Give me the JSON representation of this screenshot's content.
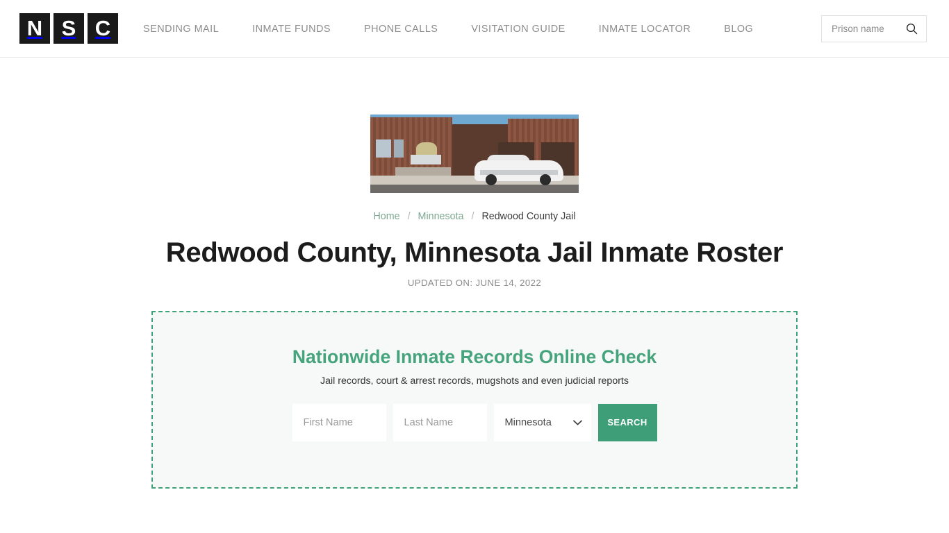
{
  "header": {
    "logo": {
      "tiles": [
        "N",
        "S",
        "C"
      ],
      "alt": "NSC"
    },
    "nav": [
      {
        "label": "SENDING MAIL"
      },
      {
        "label": "INMATE FUNDS"
      },
      {
        "label": "PHONE CALLS"
      },
      {
        "label": "VISITATION GUIDE"
      },
      {
        "label": "INMATE LOCATOR"
      },
      {
        "label": "BLOG"
      }
    ],
    "search": {
      "placeholder": "Prison name",
      "value": "",
      "icon": "search-icon"
    }
  },
  "hero": {
    "image_alt": "Redwood County Jail building exterior with corrections patrol car"
  },
  "breadcrumb": {
    "items": [
      {
        "label": "Home",
        "link": true
      },
      {
        "label": "Minnesota",
        "link": true
      },
      {
        "label": "Redwood County Jail",
        "link": false
      }
    ],
    "separator": "/"
  },
  "page": {
    "title": "Redwood County, Minnesota Jail Inmate Roster",
    "updated_on": "UPDATED ON: JUNE 14, 2022"
  },
  "promo": {
    "title": "Nationwide Inmate Records Online Check",
    "subtitle": "Jail records, court & arrest records, mugshots and even judicial reports",
    "first_name": {
      "placeholder": "First Name",
      "value": ""
    },
    "last_name": {
      "placeholder": "Last Name",
      "value": ""
    },
    "state": {
      "selected": "Minnesota",
      "options": [
        "Minnesota"
      ]
    },
    "submit_label": "SEARCH"
  },
  "colors": {
    "brand_green": "#3d9e78",
    "heading_green": "#46a47c",
    "dashed_border": "#3fa27a",
    "panel_bg": "#f7f9f9",
    "nav_text": "#8c8c8c",
    "title_text": "#1c1c1c",
    "breadcrumb_link": "#7fa894"
  }
}
